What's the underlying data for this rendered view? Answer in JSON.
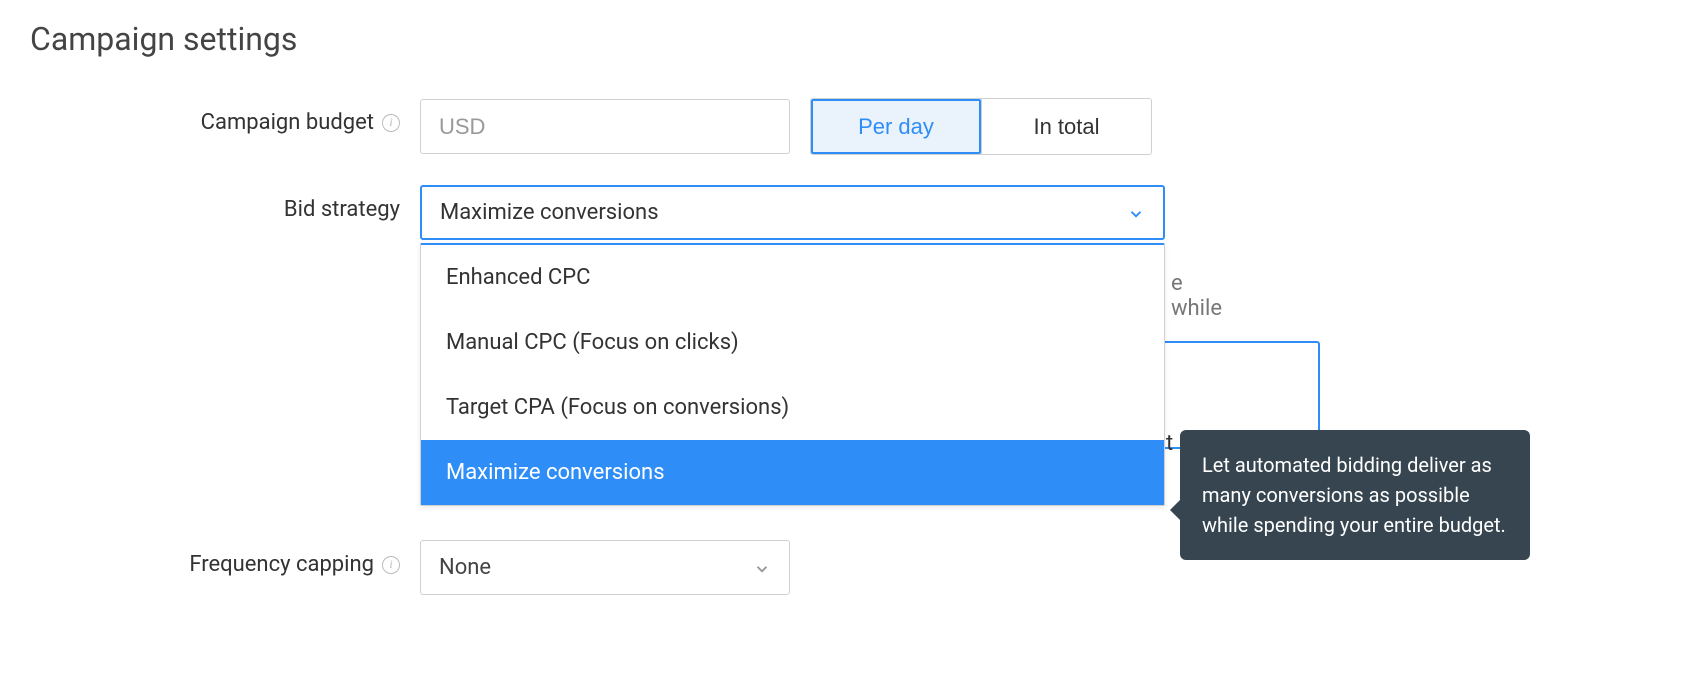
{
  "page_title": "Campaign settings",
  "budget": {
    "label": "Campaign budget",
    "placeholder": "USD",
    "toggle_per_day": "Per day",
    "toggle_in_total": "In total"
  },
  "bid_strategy": {
    "label": "Bid strategy",
    "selected": "Maximize conversions",
    "options": [
      "Enhanced CPC",
      "Manual CPC (Focus on clicks)",
      "Target CPA (Focus on conversions)",
      "Maximize conversions"
    ],
    "behind_text_fragment": "e while",
    "behind_char": "t",
    "tooltip": "Let automated bidding deliver as many conversions as possible while spending your entire budget."
  },
  "frequency_capping": {
    "label": "Frequency capping",
    "selected": "None"
  }
}
